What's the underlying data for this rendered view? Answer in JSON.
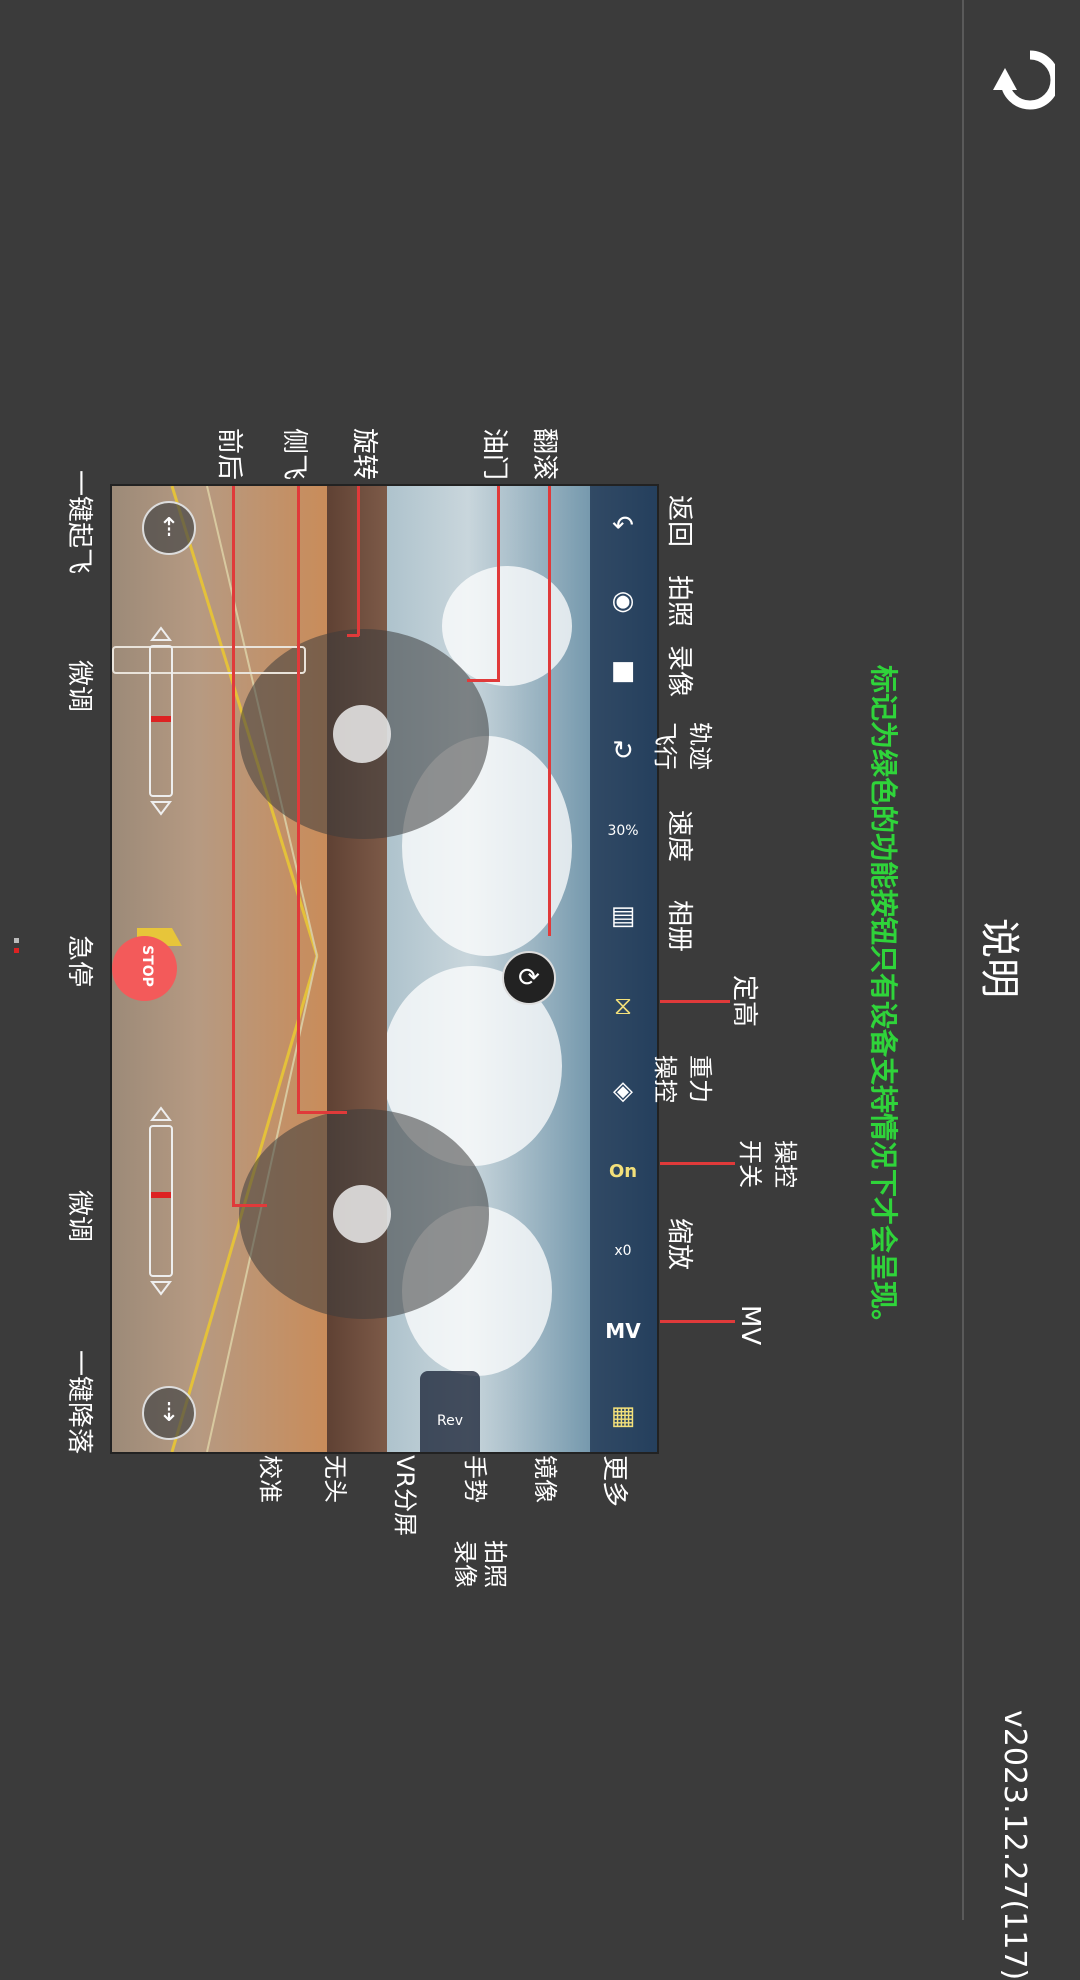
{
  "header": {
    "title": "说明",
    "version": "v2023.12.27(117)",
    "back_icon": "back-arrow-icon"
  },
  "notice": "标记为绿色的功能按钮只有设备支持情况下才会呈现。",
  "toolbar": {
    "items": [
      {
        "label": "返回",
        "icon": "back-icon"
      },
      {
        "label": "拍照",
        "icon": "camera-icon"
      },
      {
        "label": "录像",
        "icon": "video-camera-icon"
      },
      {
        "label": "轨迹飞行",
        "icon": "trajectory-icon"
      },
      {
        "label": "速度",
        "icon": "speed-icon",
        "value": "30%"
      },
      {
        "label": "相册",
        "icon": "album-icon"
      },
      {
        "label": "定高",
        "icon": "altitude-hold-icon"
      },
      {
        "label": "重力操控",
        "icon": "gravity-icon"
      },
      {
        "label": "操控开关",
        "icon": "control-switch-icon",
        "value": "On"
      },
      {
        "label": "缩放",
        "icon": "zoom-icon",
        "value": "x0"
      },
      {
        "label": "MV",
        "icon": "mv-icon",
        "value": "MV"
      },
      {
        "label": "更多",
        "icon": "more-grid-icon"
      }
    ]
  },
  "sub_toolbar": {
    "items": [
      {
        "label": "镜像",
        "icon": "rev-icon",
        "value": "Rev"
      },
      {
        "label": "手势",
        "icon": "gesture-icon"
      },
      {
        "label": "VR分屏",
        "icon": "vr-split-icon"
      },
      {
        "label": "无头",
        "icon": "headless-icon"
      },
      {
        "label": "校准",
        "icon": "calibrate-icon"
      }
    ],
    "gesture_legend": {
      "photo": "拍照",
      "record": "录像"
    }
  },
  "left_labels": [
    "翻滚",
    "油门",
    "旋转",
    "侧飞",
    "前后"
  ],
  "bottom_labels": {
    "takeoff": "一键起飞",
    "trim_left": "微调",
    "emergency_stop": "急停",
    "trim_right": "微调",
    "landing": "一键降落"
  },
  "stop_button": "STOP",
  "colors": {
    "background": "#3b3b3b",
    "notice": "#2fd43a",
    "callout_line": "#e03a3a",
    "stop": "#f35a5a"
  }
}
